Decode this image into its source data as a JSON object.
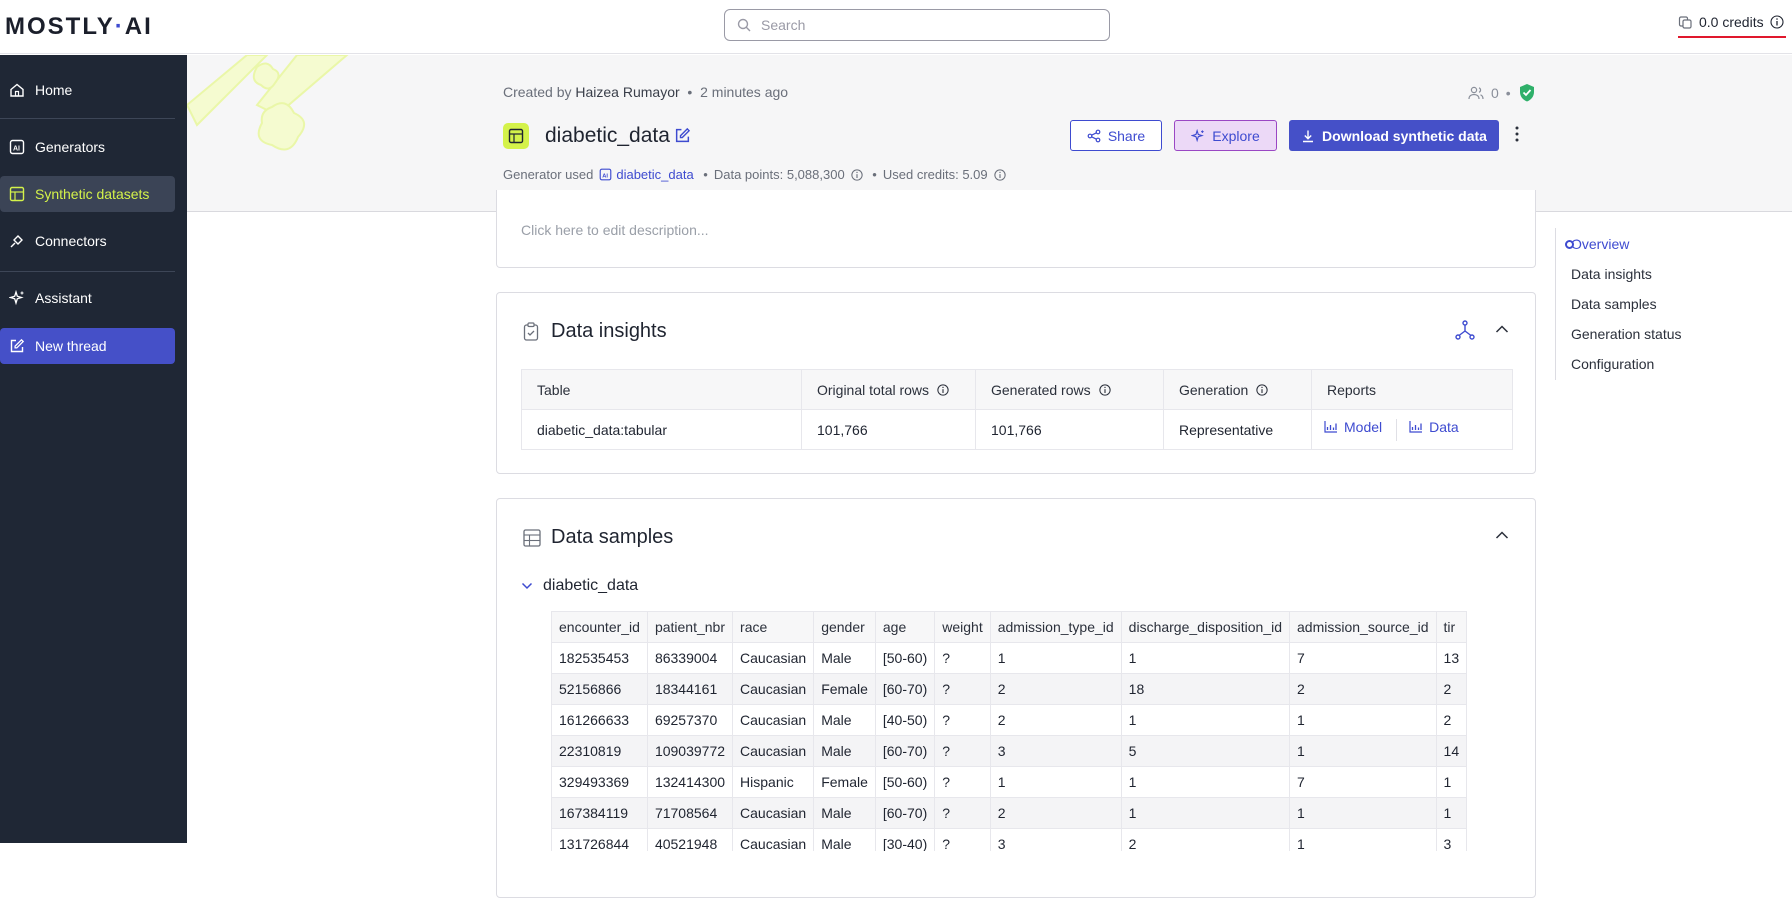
{
  "brand": {
    "logo_left": "MOSTLY",
    "logo_dot": "·",
    "logo_right": "AI"
  },
  "search": {
    "placeholder": "Search"
  },
  "credits": {
    "label": "0.0 credits"
  },
  "sidebar": {
    "items": [
      {
        "label": "Home",
        "icon": "home-icon"
      },
      {
        "label": "Generators",
        "icon": "ai-chip-icon"
      },
      {
        "label": "Synthetic datasets",
        "icon": "dataset-icon",
        "active": true
      },
      {
        "label": "Connectors",
        "icon": "plug-icon"
      },
      {
        "label": "Assistant",
        "icon": "sparkle-icon"
      },
      {
        "label": "New thread",
        "icon": "pencil-square-icon"
      }
    ]
  },
  "header": {
    "created_by_prefix": "Created by",
    "created_by_name": "Haizea Rumayor",
    "created_ago": "2 minutes ago",
    "title": "diabetic_data",
    "generator_used_label": "Generator used",
    "generator_name": "diabetic_data",
    "data_points": "Data points: 5,088,300",
    "used_credits": "Used credits: 5.09",
    "shared_count": "0",
    "share_label": "Share",
    "explore_label": "Explore",
    "download_label": "Download synthetic data"
  },
  "description": {
    "placeholder": "Click here to edit description..."
  },
  "insights": {
    "title": "Data insights",
    "columns": [
      "Table",
      "Original total rows",
      "Generated rows",
      "Generation",
      "Reports"
    ],
    "row": {
      "table": "diabetic_data:tabular",
      "original": "101,766",
      "generated": "101,766",
      "generation": "Representative",
      "report_model": "Model",
      "report_data": "Data"
    }
  },
  "samples": {
    "title": "Data samples",
    "table_name": "diabetic_data",
    "columns": [
      "encounter_id",
      "patient_nbr",
      "race",
      "gender",
      "age",
      "weight",
      "admission_type_id",
      "discharge_disposition_id",
      "admission_source_id",
      "tir"
    ],
    "rows": [
      [
        "182535453",
        "86339004",
        "Caucasian",
        "Male",
        "[50-60)",
        "?",
        "1",
        "1",
        "7",
        "13"
      ],
      [
        "52156866",
        "18344161",
        "Caucasian",
        "Female",
        "[60-70)",
        "?",
        "2",
        "18",
        "2",
        "2"
      ],
      [
        "161266633",
        "69257370",
        "Caucasian",
        "Male",
        "[40-50)",
        "?",
        "2",
        "1",
        "1",
        "2"
      ],
      [
        "22310819",
        "109039772",
        "Caucasian",
        "Male",
        "[60-70)",
        "?",
        "3",
        "5",
        "1",
        "14"
      ],
      [
        "329493369",
        "132414300",
        "Hispanic",
        "Female",
        "[50-60)",
        "?",
        "1",
        "1",
        "7",
        "1"
      ],
      [
        "167384119",
        "71708564",
        "Caucasian",
        "Male",
        "[60-70)",
        "?",
        "2",
        "1",
        "1",
        "1"
      ],
      [
        "131726844",
        "40521948",
        "Caucasian",
        "Male",
        "[30-40)",
        "?",
        "3",
        "2",
        "1",
        "3"
      ]
    ]
  },
  "toc": {
    "items": [
      "Overview",
      "Data insights",
      "Data samples",
      "Generation status",
      "Configuration"
    ]
  },
  "colors": {
    "accent": "#4550c8",
    "lime": "#d4f24a",
    "sidebar_bg": "#1f2735",
    "alert_underline": "#e0182d"
  }
}
